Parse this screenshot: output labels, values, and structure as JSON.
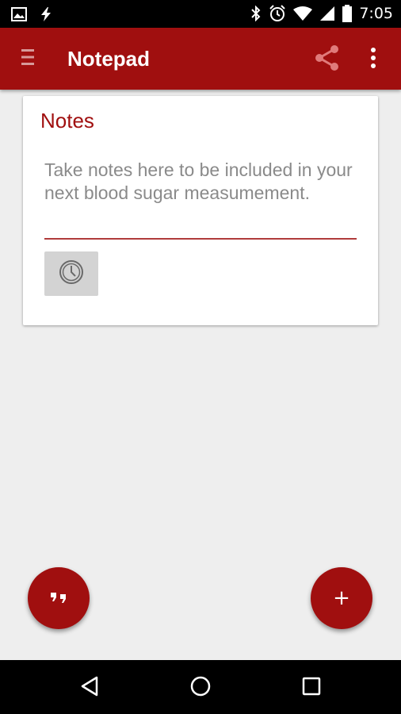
{
  "status_bar": {
    "time": "7:05",
    "left_icons": [
      "image-icon",
      "lightning-icon"
    ],
    "right_icons": [
      "bluetooth-icon",
      "alarm-icon",
      "wifi-icon",
      "signal-icon",
      "battery-icon"
    ]
  },
  "app_bar": {
    "title": "Notepad",
    "background": "#a00f0f",
    "actions": [
      "menu-icon",
      "share-icon",
      "more-vert-icon"
    ]
  },
  "notes_card": {
    "title": "Notes",
    "note_placeholder": "Take notes here to be included in your next blood sugar measumement.",
    "note_value": "",
    "time_button_icon": "clock-icon"
  },
  "fabs": {
    "left_icon": "quote-icon",
    "right_label": "+"
  },
  "nav_bar": {
    "buttons": [
      "back-icon",
      "home-icon",
      "recents-icon"
    ]
  }
}
